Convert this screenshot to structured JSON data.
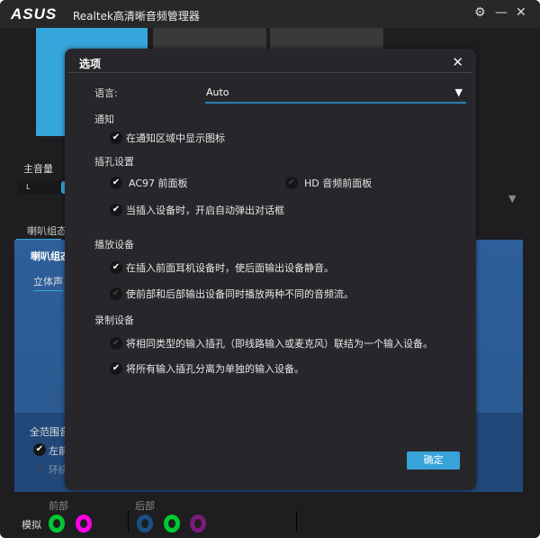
{
  "app": {
    "logo": "ASUS",
    "title": "Realtek高清晰音频管理器"
  },
  "titlebar": {
    "settings_icon": "⚙",
    "minimize_icon": "—",
    "close_icon": "✕"
  },
  "background": {
    "master_volume_label": "主音量",
    "slider_left_label": "L",
    "tab_speaker_config": "喇叭组态",
    "panel_header": "喇叭组态",
    "speaker_select": "立体声",
    "fullrange_label": "全范围音",
    "front_lr_label": "左前",
    "surround_label": "环绕",
    "front_label": "前部",
    "rear_label": "后部",
    "analog_label": "模拟",
    "jacks": {
      "front": [
        "#00c832",
        "#ff00e6"
      ],
      "rear": [
        "#1b4f86",
        "#00c832",
        "#7a1a7a"
      ]
    }
  },
  "dialog": {
    "title": "选项",
    "close_icon": "✕",
    "language_label": "语言:",
    "language_value": "Auto",
    "notify_header": "通知",
    "notify_option": {
      "label": "在通知区域中显示图标",
      "checked": true
    },
    "jack_header": "插孔设置",
    "ac97": {
      "label": "AC97 前面板",
      "checked": true
    },
    "hd": {
      "label": "HD 音频前面板",
      "checked": false
    },
    "auto_popup": {
      "label": "当插入设备时，开启自动弹出对话框",
      "checked": true
    },
    "playback_header": "播放设备",
    "mute_rear": {
      "label": "在插入前面耳机设备时，使后面输出设备静音。",
      "checked": true
    },
    "dual_stream": {
      "label": "使前部和后部输出设备同时播放两种不同的音频流。",
      "checked": false
    },
    "record_header": "录制设备",
    "combine_inputs": {
      "label": "将相同类型的输入插孔（即线路输入或麦克风）联结为一个输入设备。",
      "checked": false
    },
    "separate_inputs": {
      "label": "将所有输入插孔分离为单独的输入设备。",
      "checked": true
    },
    "ok_label": "确定"
  }
}
